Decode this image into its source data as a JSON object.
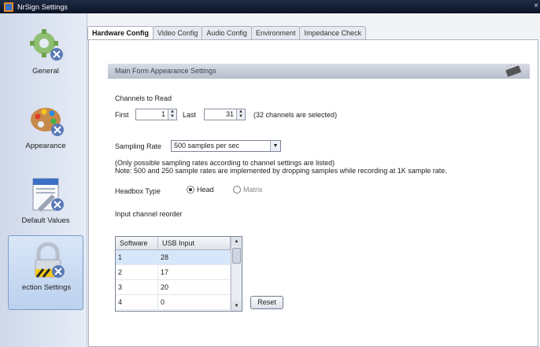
{
  "window": {
    "title": "NrSign Settings",
    "close_glyph": "×"
  },
  "sidebar": {
    "items": [
      {
        "label": "General",
        "icon": "gears-icon"
      },
      {
        "label": "Appearance",
        "icon": "palette-icon"
      },
      {
        "label": "Default Values",
        "icon": "document-icon"
      },
      {
        "label": "ection Settings",
        "icon": "lock-icon",
        "selected": true
      }
    ]
  },
  "tabs": [
    {
      "label": "Hardware Config",
      "active": true
    },
    {
      "label": "Video Config"
    },
    {
      "label": "Audio Config"
    },
    {
      "label": "Environment"
    },
    {
      "label": "Impedance Check"
    }
  ],
  "section": {
    "title": "Main Form Appearance Settings",
    "icon": "chip-icon"
  },
  "channels": {
    "heading": "Channels to Read",
    "first_label": "First",
    "first_value": "1",
    "last_label": "Last",
    "last_value": "31",
    "note": "(32 channels are selected)"
  },
  "sampling": {
    "label": "Sampling Rate",
    "value": "500 samples per sec",
    "note1": "(Only possible sampling rates according to channel settings are listed)",
    "note2": "Note: 500 and 250 sample rates are implemented by dropping samples while recording at 1K sample rate."
  },
  "headbox": {
    "label": "Headbox Type",
    "options": [
      {
        "label": "Head",
        "selected": true
      },
      {
        "label": "Matrix",
        "selected": false
      }
    ]
  },
  "input_order": {
    "label": "Input channel reorder",
    "columns": [
      "Software",
      "USB Input"
    ],
    "rows": [
      [
        "1",
        "28"
      ],
      [
        "2",
        "17"
      ],
      [
        "3",
        "20"
      ],
      [
        "4",
        "0"
      ]
    ]
  },
  "reset_label": "Reset"
}
